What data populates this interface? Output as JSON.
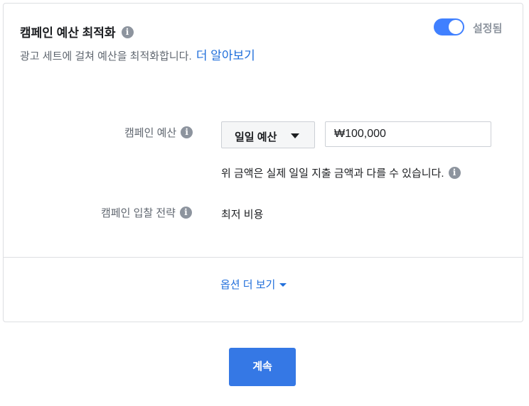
{
  "header": {
    "title": "캠페인 예산 최적화",
    "subtitle": "광고 세트에 걸쳐 예산을 최적화합니다.",
    "learn_more": "더 알아보기",
    "toggle_state": "on",
    "toggle_label": "설정됨"
  },
  "budget": {
    "label": "캠페인 예산",
    "type_selected": "일일 예산",
    "amount": "₩100,000",
    "note": "위 금액은 실제 일일 지출 금액과 다를 수 있습니다."
  },
  "bid_strategy": {
    "label": "캠페인 입찰 전략",
    "value": "최저 비용"
  },
  "more_options": "옵션 더 보기",
  "continue_button": "계속",
  "icons": {
    "info": "info-icon",
    "dropdown": "caret-down-icon"
  },
  "colors": {
    "accent": "#4080ff",
    "link": "#216fdb",
    "button": "#3578e5"
  }
}
